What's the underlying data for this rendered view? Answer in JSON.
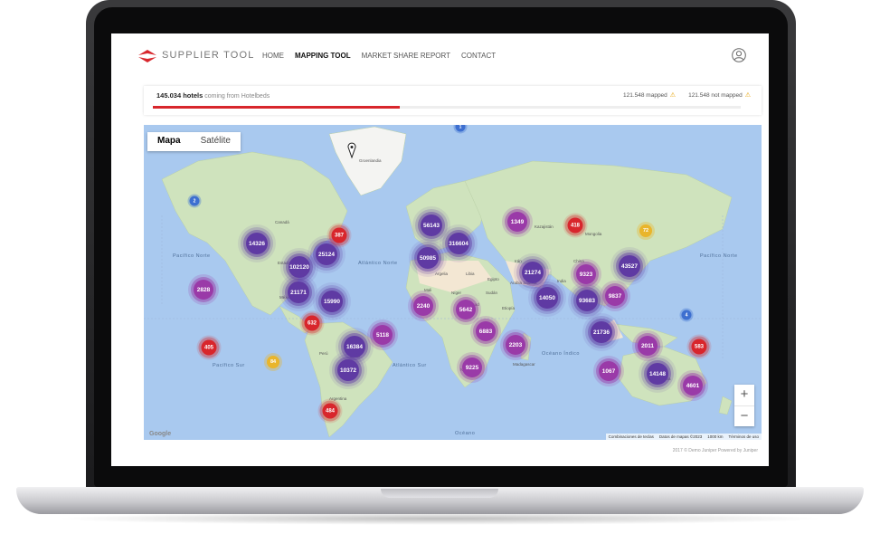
{
  "app": {
    "brand": "SUPPLIER TOOL",
    "brand_color": "#d8262c",
    "nav": [
      "HOME",
      "MAPPING TOOL",
      "MARKET SHARE REPORT",
      "CONTACT"
    ],
    "active_nav": "MAPPING TOOL"
  },
  "status": {
    "hotels_count": "145.034 hotels",
    "hotels_source": "coming from Hotelbeds",
    "mapped": "121.548 mapped",
    "not_mapped": "121.548 not mapped",
    "progress_fraction": 0.42
  },
  "map": {
    "type_options": [
      "Mapa",
      "Satélite"
    ],
    "selected_type": "Mapa",
    "zoom_in": "+",
    "zoom_out": "−",
    "logo": "Google",
    "attribution": [
      "Combinaciones de teclas",
      "Datos de mapas ©2023",
      "1000 km",
      "Términos de uso"
    ],
    "ocean_labels": [
      "Pacífico Norte",
      "Pacífico Norte",
      "Atlántico Norte",
      "Pacífico Sur",
      "Atlántico Sur",
      "Océano Índico",
      "Océano"
    ],
    "place_labels": [
      "Groenlandia",
      "Canadá",
      "Estados Unidos",
      "México",
      "Brasil",
      "Perú",
      "Argentina",
      "Kazajistán",
      "Mongolia",
      "China",
      "India",
      "Irán",
      "Argelia",
      "Libia",
      "Egipto",
      "Mali",
      "Níger",
      "Sudán",
      "Chad",
      "Etiopía",
      "Namibia",
      "Madagascar",
      "Arabia Saudita",
      "Australia"
    ],
    "clusters": {
      "purple": [
        "14326",
        "56143",
        "316604",
        "102120",
        "25124",
        "50985",
        "21171",
        "15990",
        "21274",
        "43527",
        "14050",
        "93683",
        "21736",
        "16384",
        "10372",
        "14148"
      ],
      "magenta": [
        "1349",
        "9323",
        "2828",
        "9837",
        "2240",
        "5642",
        "5118",
        "6883",
        "2203",
        "9225",
        "1067",
        "2011",
        "4601"
      ],
      "red": [
        "387",
        "418",
        "632",
        "405",
        "583",
        "484"
      ],
      "yellow": [
        "72",
        "84"
      ],
      "blue": [
        "2",
        "1",
        "4"
      ]
    }
  },
  "footer": "2017 © Demo Juniper Powered by Juniper"
}
